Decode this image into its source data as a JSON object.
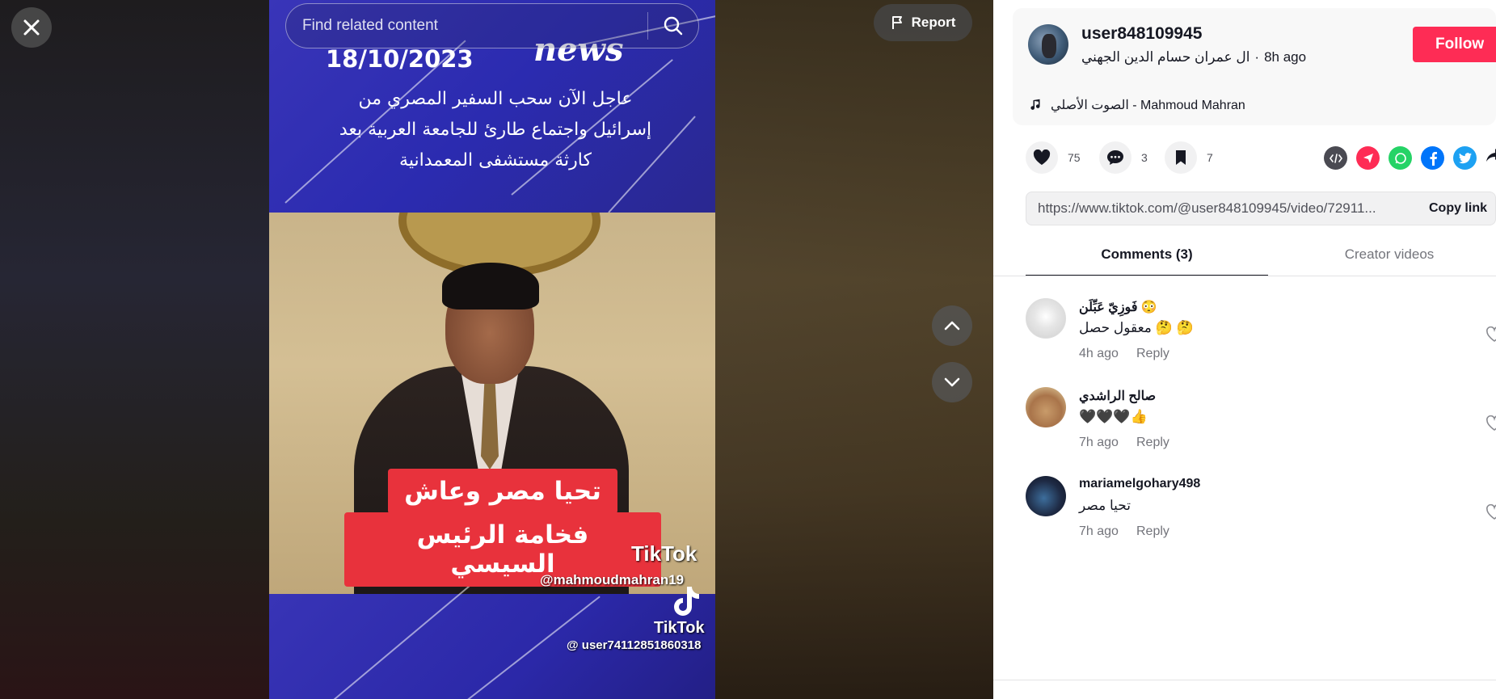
{
  "search": {
    "placeholder": "Find related content"
  },
  "controls": {
    "report_label": "Report"
  },
  "video": {
    "date": "18/10/2023",
    "channel_mark": "news",
    "headline": "عاجل الآن  سحب السفير المصري من إسرائيل واجتماع طارئ للجامعة العربية بعد كارثة مستشفى المعمدانية",
    "caption_line1": "تحيا مصر وعاش",
    "caption_line2": "فخامة الرئيس السيسي",
    "watermark1_brand": "TikTok",
    "watermark1_user": "@mahmoudmahran19",
    "watermark2_brand": "TikTok",
    "watermark2_user": "@ user74112851860318"
  },
  "author": {
    "username": "user848109945",
    "display_name": "ال عمران حسام الدين الجهني",
    "posted": "8h ago",
    "follow_label": "Follow",
    "music": "الصوت الأصلي - Mahmoud Mahran"
  },
  "stats": {
    "likes": "75",
    "comments": "3",
    "saves": "7"
  },
  "share": {
    "link": "https://www.tiktok.com/@user848109945/video/72911...",
    "copy_label": "Copy link",
    "icons": [
      "embed-icon",
      "send-to-friends-icon",
      "whatsapp-icon",
      "facebook-icon",
      "twitter-icon",
      "share-more-icon"
    ]
  },
  "tabs": {
    "comments": "Comments (3)",
    "creator": "Creator videos"
  },
  "comments": [
    {
      "name": "فَوزِيّ عَبِّلَن 😳",
      "text": "معقول حصل 🤔 🤔",
      "time": "4h ago",
      "reply": "Reply"
    },
    {
      "name": "صالح الراشدي",
      "text": "🖤🖤🖤👍",
      "time": "7h ago",
      "reply": "Reply"
    },
    {
      "name": "mariamelgohary498",
      "text": "تحيا مصر",
      "time": "7h ago",
      "reply": "Reply"
    }
  ],
  "colors": {
    "follow": "#fe2c55",
    "whatsapp": "#25d366",
    "facebook": "#0075fa",
    "twitter": "#1da1f2"
  }
}
